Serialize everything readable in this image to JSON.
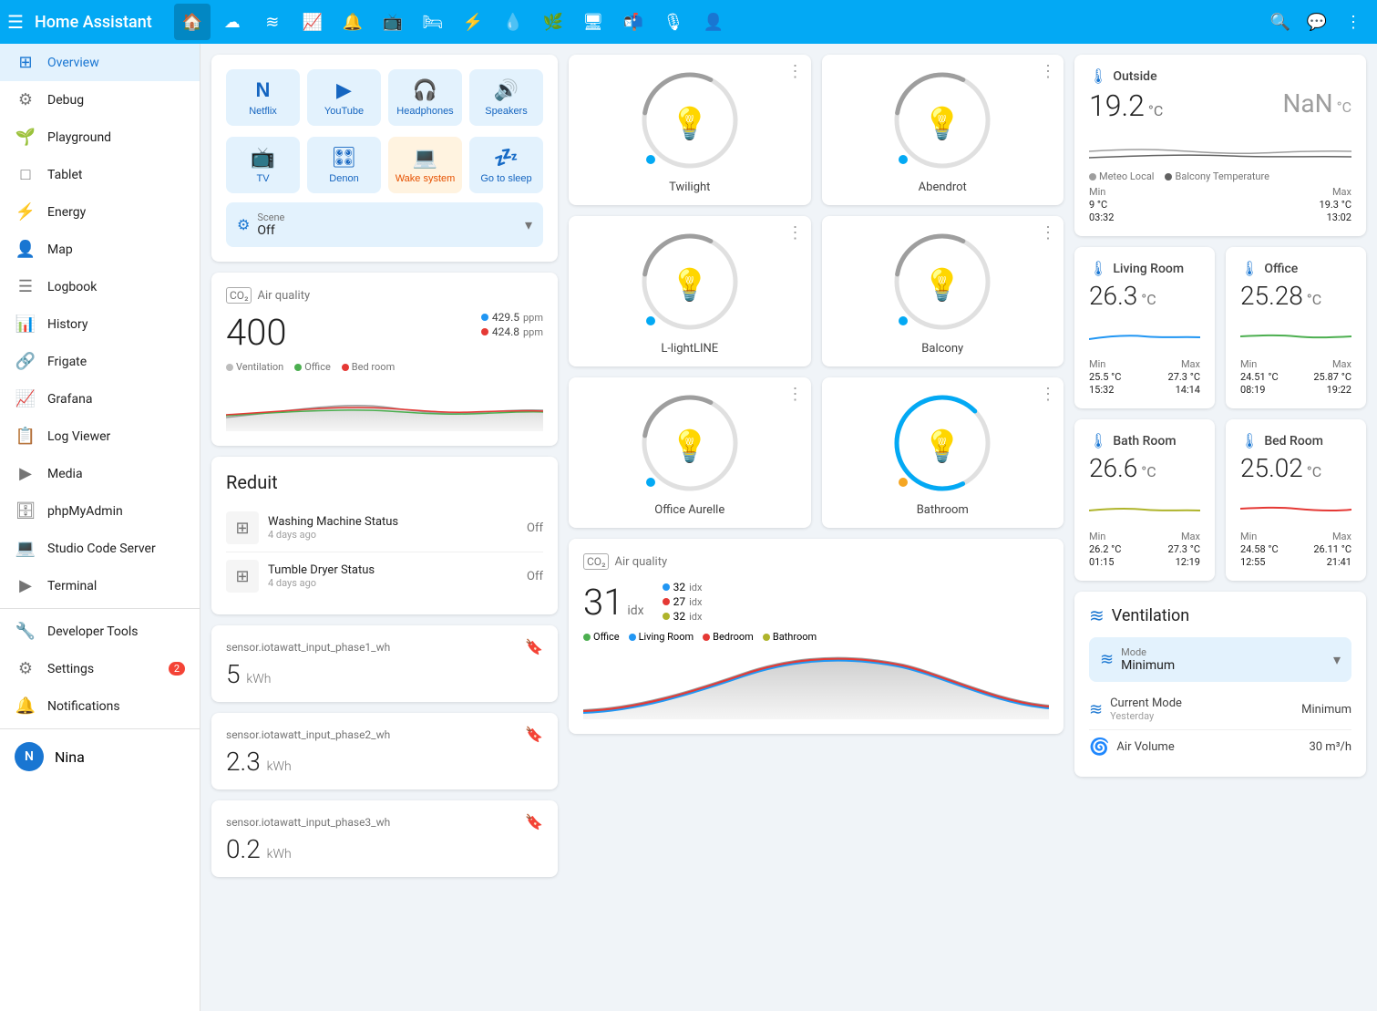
{
  "app": {
    "title": "Home Assistant",
    "menu_icon": "☰"
  },
  "top_nav": {
    "icons": [
      "🏠",
      "🌡",
      "≋",
      "📈",
      "🔔",
      "📺",
      "🛏",
      "⚡",
      "💧",
      "🌿",
      "🖥",
      "📬",
      "🎙",
      "👤"
    ]
  },
  "sidebar": {
    "active": "Overview",
    "items": [
      {
        "label": "Overview",
        "icon": "⊞"
      },
      {
        "label": "Debug",
        "icon": "🐛"
      },
      {
        "label": "Playground",
        "icon": "🌱"
      },
      {
        "label": "Tablet",
        "icon": "📱"
      },
      {
        "label": "Energy",
        "icon": "⚡"
      },
      {
        "label": "Map",
        "icon": "👤"
      },
      {
        "label": "Logbook",
        "icon": "☰"
      },
      {
        "label": "History",
        "icon": "📊"
      },
      {
        "label": "Frigate",
        "icon": "🔗"
      },
      {
        "label": "Grafana",
        "icon": "📈"
      },
      {
        "label": "Log Viewer",
        "icon": "📋"
      },
      {
        "label": "Media",
        "icon": "▶"
      },
      {
        "label": "phpMyAdmin",
        "icon": "🗄"
      },
      {
        "label": "Studio Code Server",
        "icon": "💻"
      },
      {
        "label": "Terminal",
        "icon": "▶"
      }
    ],
    "tools": [
      {
        "label": "Developer Tools",
        "icon": "🔧"
      },
      {
        "label": "Settings",
        "icon": "⚙",
        "badge": "2"
      },
      {
        "label": "Notifications",
        "icon": "🔔"
      }
    ],
    "user": {
      "initial": "N",
      "name": "Nina"
    }
  },
  "media": {
    "buttons": [
      {
        "label": "Netflix",
        "icon": "N"
      },
      {
        "label": "YouTube",
        "icon": "▶"
      },
      {
        "label": "Headphones",
        "icon": "🎧"
      },
      {
        "label": "Speakers",
        "icon": "🔊"
      },
      {
        "label": "TV",
        "icon": "📺"
      },
      {
        "label": "Denon",
        "icon": "🎛"
      },
      {
        "label": "Wake system",
        "icon": "💻",
        "type": "wake"
      },
      {
        "label": "Go to sleep",
        "icon": "💤"
      }
    ],
    "scene": {
      "label": "Scene",
      "value": "Off"
    }
  },
  "air_quality_left": {
    "title": "Air quality",
    "value": "400",
    "readings": [
      {
        "value": "429.5",
        "unit": "ppm",
        "color": "#2196f3"
      },
      {
        "value": "424.8",
        "unit": "ppm",
        "color": "#e53935"
      }
    ],
    "legend": [
      {
        "label": "Ventilation",
        "color": "#bdbdbd"
      },
      {
        "label": "Office",
        "color": "#4caf50"
      },
      {
        "label": "Bed room",
        "color": "#e53935"
      }
    ]
  },
  "reduit": {
    "title": "Reduit",
    "devices": [
      {
        "name": "Washing Machine Status",
        "time": "4 days ago",
        "status": "Off"
      },
      {
        "name": "Tumble Dryer Status",
        "time": "4 days ago",
        "status": "Off"
      }
    ]
  },
  "sensors": [
    {
      "name": "sensor.iotawatt_input_phase1_wh",
      "value": "5",
      "unit": "kWh"
    },
    {
      "name": "sensor.iotawatt_input_phase2_wh",
      "value": "2.3",
      "unit": "kWh"
    },
    {
      "name": "sensor.iotawatt_input_phase3_wh",
      "value": "0.2",
      "unit": "kWh"
    }
  ],
  "lights": [
    {
      "name": "Twilight",
      "on": false,
      "brightness": 30
    },
    {
      "name": "Abendrot",
      "on": false,
      "brightness": 30
    },
    {
      "name": "L-lightLINE",
      "on": false,
      "brightness": 30
    },
    {
      "name": "Balcony",
      "on": false,
      "brightness": 30
    },
    {
      "name": "Office Aurelle",
      "on": false,
      "brightness": 30
    },
    {
      "name": "Bathroom",
      "on": true,
      "brightness": 80
    }
  ],
  "air_quality_mid": {
    "title": "Air quality",
    "value": "31",
    "unit": "idx",
    "readings": [
      {
        "value": "32",
        "unit": "idx",
        "color": "#2196f3"
      },
      {
        "value": "27",
        "unit": "idx",
        "color": "#e53935"
      },
      {
        "value": "32",
        "unit": "idx",
        "color": "#afb42b"
      }
    ],
    "legend": [
      {
        "label": "Office",
        "color": "#4caf50"
      },
      {
        "label": "Living Room",
        "color": "#2196f3"
      },
      {
        "label": "Bedroom",
        "color": "#e53935"
      },
      {
        "label": "Bathroom",
        "color": "#afb42b"
      }
    ]
  },
  "temperatures": {
    "outside": {
      "room": "Outside",
      "value": "19.2",
      "nan": "NaN",
      "legend": [
        {
          "label": "Meteo Local",
          "color": "#9e9e9e"
        },
        {
          "label": "Balcony Temperature",
          "color": "#616161"
        }
      ],
      "stats": {
        "min_label": "Min",
        "min_val": "9 °C",
        "min_time": "03:32",
        "max_label": "Max",
        "max_val": "19.3 °C",
        "max_time": "13:02"
      }
    },
    "rooms": [
      {
        "room": "Living Room",
        "value": "26.3",
        "chart_color": "#2196f3",
        "stats": {
          "min": "25.5 °C",
          "min_t": "15:32",
          "max": "27.3 °C",
          "max_t": "14:14"
        }
      },
      {
        "room": "Office",
        "value": "25.28",
        "chart_color": "#4caf50",
        "stats": {
          "min": "24.51 °C",
          "min_t": "08:19",
          "max": "25.87 °C",
          "max_t": "19:22"
        }
      },
      {
        "room": "Bath Room",
        "value": "26.6",
        "chart_color": "#afb42b",
        "stats": {
          "min": "26.2 °C",
          "min_t": "01:15",
          "max": "27.3 °C",
          "max_t": "12:19"
        }
      },
      {
        "room": "Bed Room",
        "value": "25.02",
        "chart_color": "#e53935",
        "stats": {
          "min": "24.58 °C",
          "min_t": "12:55",
          "max": "26.11 °C",
          "max_t": "21:41"
        }
      }
    ]
  },
  "ventilation": {
    "title": "Ventilation",
    "mode_label": "Mode",
    "mode_value": "Minimum",
    "rows": [
      {
        "label": "Current Mode",
        "sub": "Yesterday",
        "value": "Minimum"
      },
      {
        "label": "Air Volume",
        "sub": "",
        "value": "30 m³/h"
      }
    ]
  }
}
